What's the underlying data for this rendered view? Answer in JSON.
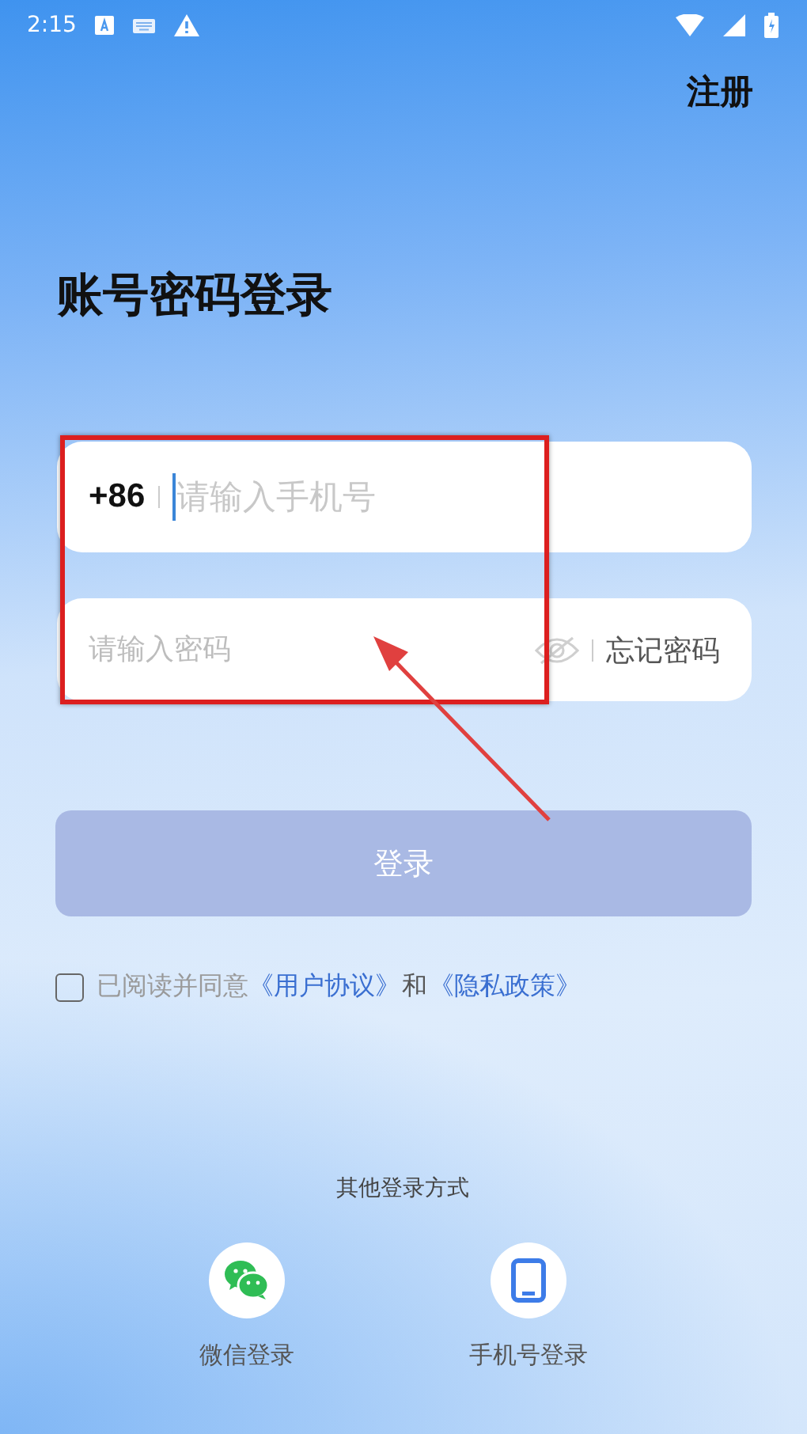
{
  "status_bar": {
    "time": "2:15"
  },
  "register_link": "注册",
  "title": "账号密码登录",
  "phone_field": {
    "country_code": "+86",
    "placeholder": "请输入手机号",
    "focused": true
  },
  "password_field": {
    "placeholder": "请输入密码",
    "password_visible": false,
    "forgot_link": "忘记密码"
  },
  "login_button": {
    "label": "登录",
    "disabled": true
  },
  "agreement": {
    "checked": false,
    "text": "已阅读并同意",
    "links": [
      "《用户协议》",
      "《隐私政策》"
    ],
    "joiner": "和"
  },
  "other_methods": {
    "heading": "其他登录方式",
    "options": [
      {
        "kind": "wechat",
        "label": "微信登录"
      },
      {
        "kind": "phone",
        "label": "手机号登录"
      }
    ]
  }
}
